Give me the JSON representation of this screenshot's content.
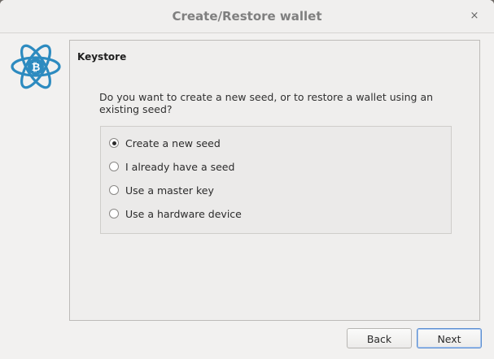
{
  "window": {
    "title": "Create/Restore wallet",
    "close_glyph": "×"
  },
  "logo": {
    "icon": "electrum-bitcoin-atom-icon",
    "color": "#2d8bc0"
  },
  "panel": {
    "title": "Keystore",
    "question": "Do you want to create a new seed, or to restore a wallet using an existing seed?",
    "options": [
      {
        "label": "Create a new seed",
        "checked": true
      },
      {
        "label": "I already have a seed",
        "checked": false
      },
      {
        "label": "Use a master key",
        "checked": false
      },
      {
        "label": "Use a hardware device",
        "checked": false
      }
    ]
  },
  "buttons": {
    "back_label": "Back",
    "next_label": "Next"
  }
}
